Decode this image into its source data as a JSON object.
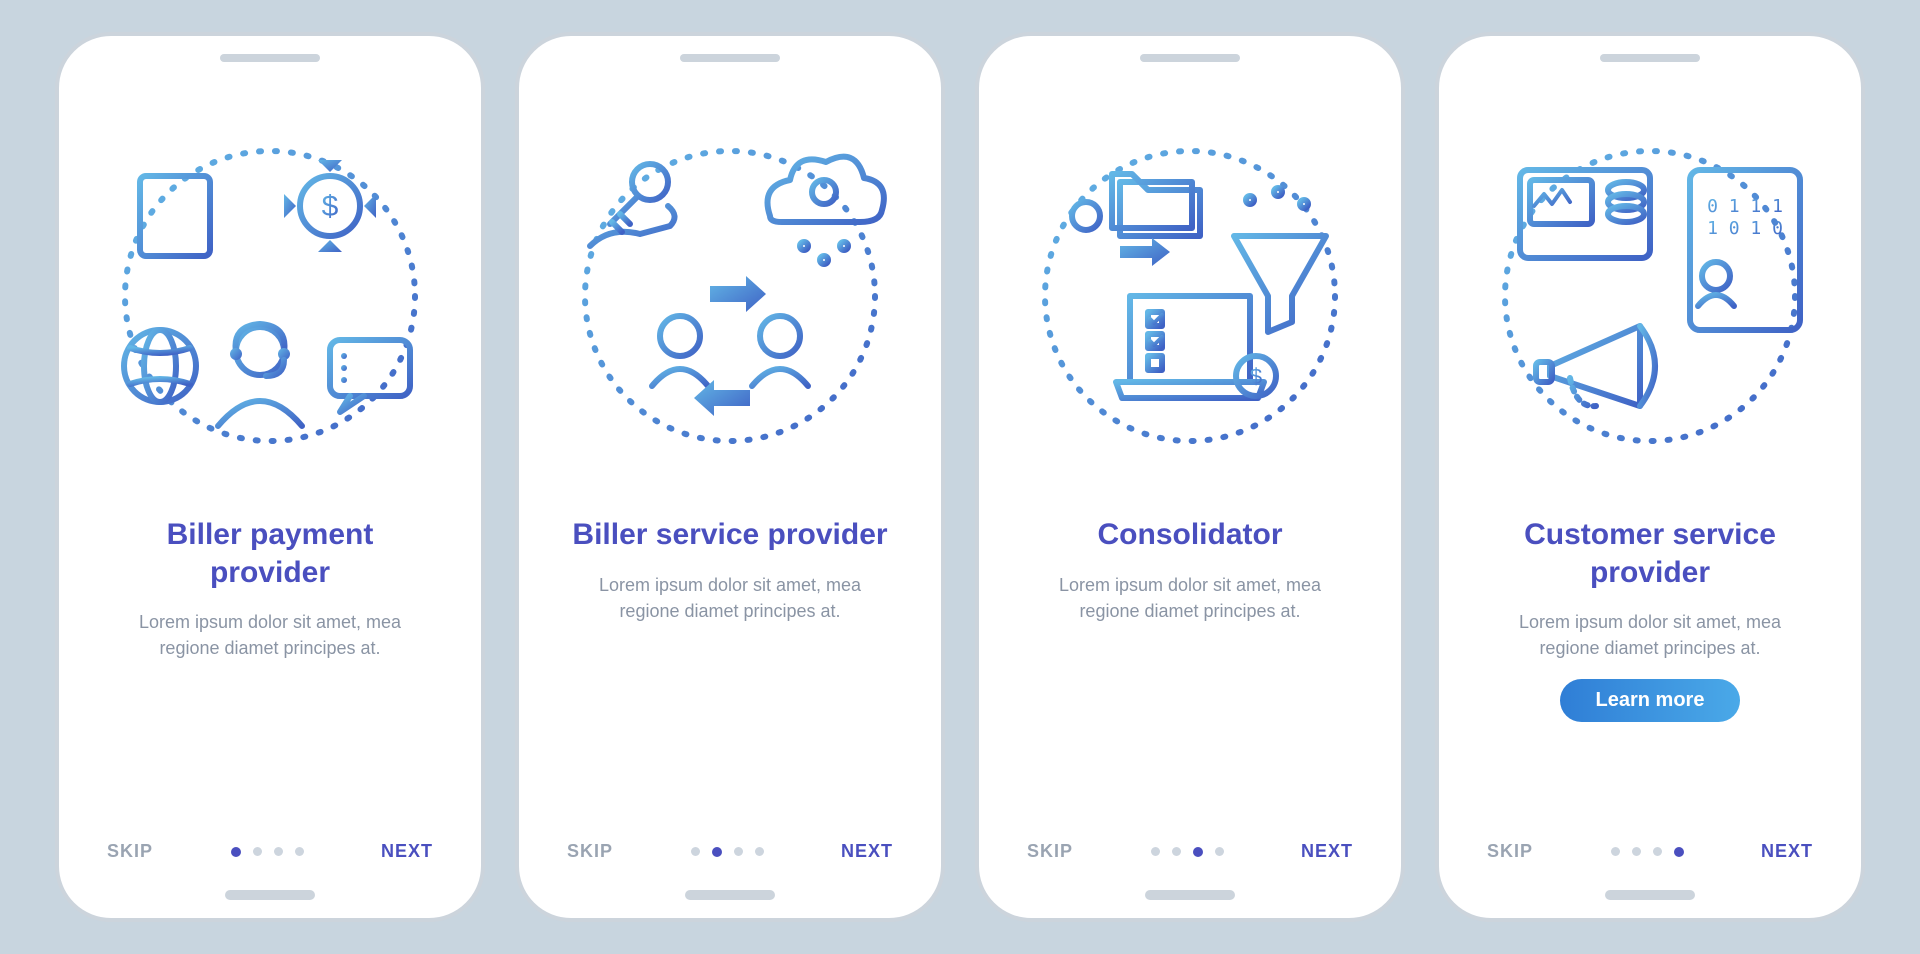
{
  "nav": {
    "skip": "SKIP",
    "next": "NEXT"
  },
  "cta": "Learn more",
  "lorem": "Lorem ipsum dolor sit amet, mea regione diamet principes at.",
  "screens": [
    {
      "title": "Biller payment provider",
      "desc": "Lorem ipsum dolor sit amet, mea regione diamet principes at.",
      "active_dot": 0,
      "has_cta": false
    },
    {
      "title": "Biller service provider",
      "desc": "Lorem ipsum dolor sit amet, mea regione diamet principes at.",
      "active_dot": 1,
      "has_cta": false
    },
    {
      "title": "Consolidator",
      "desc": "Lorem ipsum dolor sit amet, mea regione diamet principes at.",
      "active_dot": 2,
      "has_cta": false
    },
    {
      "title": "Customer service provider",
      "desc": "Lorem ipsum dolor sit amet, mea regione diamet principes at.",
      "active_dot": 3,
      "has_cta": true
    }
  ],
  "colors": {
    "title": "#4a4fbf",
    "desc": "#8a94a4",
    "skip": "#9aa4b2",
    "next": "#4a4fbf",
    "cta_start": "#2f7ed6",
    "cta_end": "#4aa9e8",
    "stroke_light": "#63b7e6",
    "stroke_dark": "#3f62c5"
  }
}
